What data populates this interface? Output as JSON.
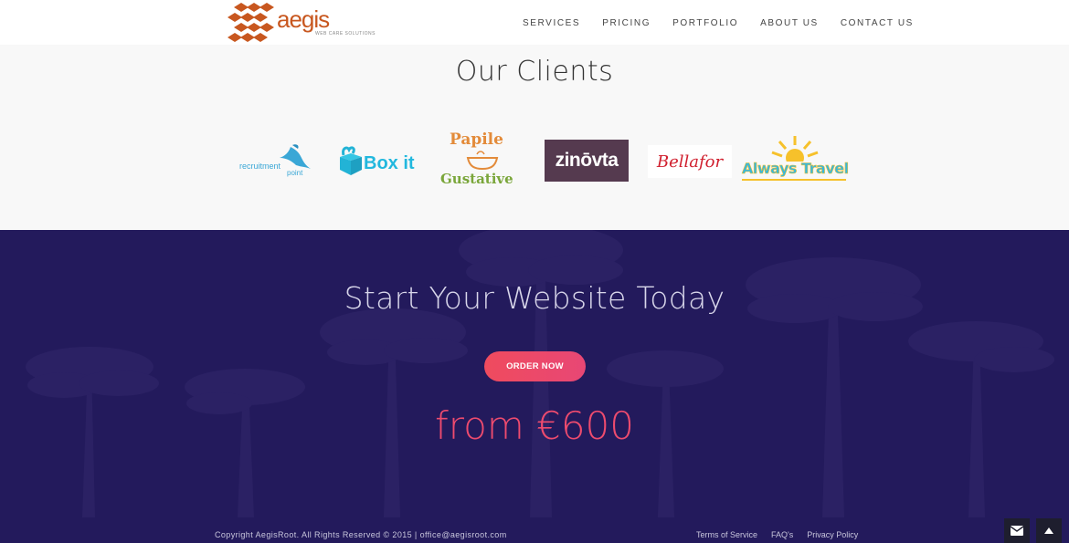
{
  "header": {
    "logo": {
      "text": "aegis",
      "tagline": "WEB CARE SOLUTIONS",
      "icon": "diamond-tiles-logo",
      "color": "#c8571f"
    },
    "nav": [
      {
        "label": "SERVICES"
      },
      {
        "label": "PRICING"
      },
      {
        "label": "PORTFOLIO"
      },
      {
        "label": "ABOUT US"
      },
      {
        "label": "CONTACT US"
      }
    ]
  },
  "clients": {
    "title": "Our Clients",
    "logos": [
      {
        "text1": "recruitment",
        "text2": "point",
        "icon": "bird-icon"
      },
      {
        "text": "Box it",
        "icon": "box-icon"
      },
      {
        "text1": "Papile",
        "text2": "Gustative",
        "icon": "soup-bowl-icon"
      },
      {
        "text": "zinōvta"
      },
      {
        "text": "Bellafor"
      },
      {
        "text": "Always Travel",
        "icon": "sun-icon"
      }
    ]
  },
  "order": {
    "title": "Start Your Website Today",
    "button_label": "ORDER NOW",
    "price": "from €600",
    "background_color": "#231a5c",
    "accent_color": "#ee4b6e"
  },
  "footer": {
    "copyright": "Copyright AegisRoot. All Rights Reserved © 2015 | office@aegisroot.com",
    "links": [
      {
        "label": "Terms of Service"
      },
      {
        "label": "FAQ's"
      },
      {
        "label": "Privacy Policy"
      }
    ],
    "mail_icon": "envelope-icon",
    "top_icon": "chevron-up-icon"
  }
}
